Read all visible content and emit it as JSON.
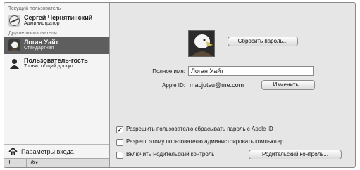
{
  "sidebar": {
    "current_user_header": "Текущий пользователь",
    "current_user": {
      "name": "Сергей Чернятинский",
      "role": "Администратор"
    },
    "other_users_header": "Другие пользователи",
    "users": [
      {
        "name": "Логан Уайт",
        "role": "Стандартная",
        "selected": true
      },
      {
        "name": "Пользователь-гость",
        "role": "Только общий доступ",
        "selected": false
      }
    ],
    "login_options_label": "Параметры входа",
    "bottom_buttons": {
      "add": "+",
      "remove": "−",
      "action": "⚙▾"
    }
  },
  "details": {
    "reset_password_button": "Сбросить пароль...",
    "full_name_label": "Полное имя:",
    "full_name_value": "Логан Уайт",
    "apple_id_label": "Apple ID:",
    "apple_id_value": "macjutsu@me.com",
    "change_button": "Изменить...",
    "checkboxes": [
      {
        "label": "Разрешить пользователю сбрасывать пароль с Apple ID",
        "checked": true,
        "mark": "✓"
      },
      {
        "label": "Разреш. этому пользователю администрировать компьютер",
        "checked": false,
        "mark": ""
      },
      {
        "label": "Включить Родительский контроль",
        "checked": false,
        "mark": ""
      }
    ],
    "parental_controls_button": "Родительский контроль..."
  }
}
